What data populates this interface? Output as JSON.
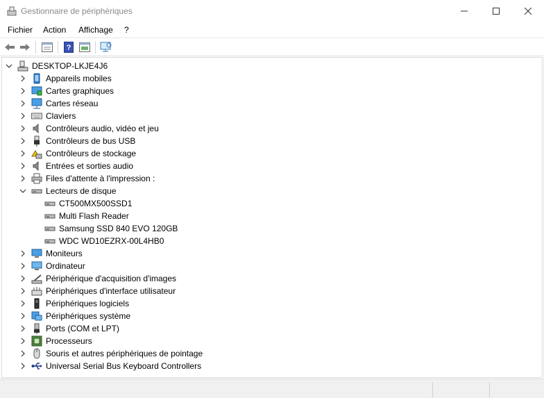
{
  "window": {
    "title": "Gestionnaire de périphériques",
    "icon": "device-manager-icon",
    "controls": [
      "minimize",
      "maximize",
      "close"
    ]
  },
  "menu": [
    "Fichier",
    "Action",
    "Affichage",
    "?"
  ],
  "toolbar": {
    "buttons": [
      "back-arrow-icon",
      "forward-arrow-icon",
      "properties-icon",
      "help-icon",
      "update-view-icon",
      "scan-hardware-icon"
    ]
  },
  "tree": {
    "root": "DESKTOP-LKJE4J6",
    "categories": [
      {
        "label": "Appareils mobiles",
        "icon": "mobile-device-icon",
        "expanded": false
      },
      {
        "label": "Cartes graphiques",
        "icon": "display-adapter-icon",
        "expanded": false
      },
      {
        "label": "Cartes réseau",
        "icon": "network-adapter-icon",
        "expanded": false
      },
      {
        "label": "Claviers",
        "icon": "keyboard-icon",
        "expanded": false
      },
      {
        "label": "Contrôleurs audio, vidéo et jeu",
        "icon": "speaker-icon",
        "expanded": false
      },
      {
        "label": "Contrôleurs de bus USB",
        "icon": "usb-plug-icon",
        "expanded": false
      },
      {
        "label": "Contrôleurs de stockage",
        "icon": "storage-controller-icon",
        "expanded": false
      },
      {
        "label": "Entrées et sorties audio",
        "icon": "speaker-icon",
        "expanded": false
      },
      {
        "label": "Files d'attente à l'impression :",
        "icon": "printer-icon",
        "expanded": false
      },
      {
        "label": "Lecteurs de disque",
        "icon": "disk-drive-icon",
        "expanded": true,
        "children": [
          "CT500MX500SSD1",
          "Multi Flash Reader",
          "Samsung SSD 840 EVO 120GB",
          "WDC WD10EZRX-00L4HB0"
        ]
      },
      {
        "label": "Moniteurs",
        "icon": "monitor-icon",
        "expanded": false
      },
      {
        "label": "Ordinateur",
        "icon": "computer-icon",
        "expanded": false
      },
      {
        "label": "Périphérique d'acquisition d'images",
        "icon": "camera-scanner-icon",
        "expanded": false
      },
      {
        "label": "Périphériques d'interface utilisateur",
        "icon": "hid-icon",
        "expanded": false
      },
      {
        "label": "Périphériques logiciels",
        "icon": "software-device-icon",
        "expanded": false
      },
      {
        "label": "Périphériques système",
        "icon": "system-device-icon",
        "expanded": false
      },
      {
        "label": "Ports (COM et LPT)",
        "icon": "port-icon",
        "expanded": false
      },
      {
        "label": "Processeurs",
        "icon": "processor-icon",
        "expanded": false
      },
      {
        "label": "Souris et autres périphériques de pointage",
        "icon": "mouse-icon",
        "expanded": false
      },
      {
        "label": "Universal Serial Bus Keyboard Controllers",
        "icon": "usb-symbol-icon",
        "expanded": false
      }
    ]
  }
}
